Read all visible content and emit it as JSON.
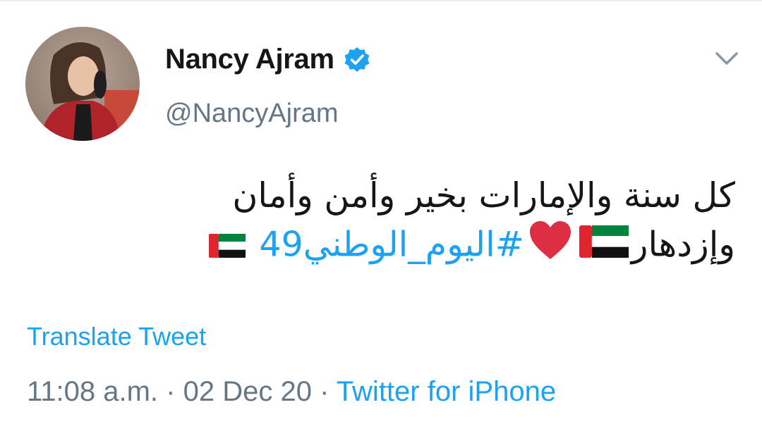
{
  "tweet": {
    "display_name": "Nancy Ajram",
    "handle": "@NancyAjram",
    "text_line1": "كل سنة والإمارات بخير وأمن وأمان",
    "text_line2_word": "وإزدهار",
    "hashtag": "#اليوم_الوطني49",
    "translate_label": "Translate Tweet",
    "time": "11:08 a.m.",
    "separator": "·",
    "date": "02 Dec 20",
    "source": "Twitter for iPhone"
  },
  "icons": {
    "verified": "verified-badge-icon",
    "caret": "chevron-down-icon",
    "flag": "uae-flag-emoji",
    "heart": "red-heart-emoji"
  },
  "colors": {
    "link": "#1da1f2",
    "name": "#14171a",
    "secondary": "#657786",
    "heart": "#e0245e"
  }
}
